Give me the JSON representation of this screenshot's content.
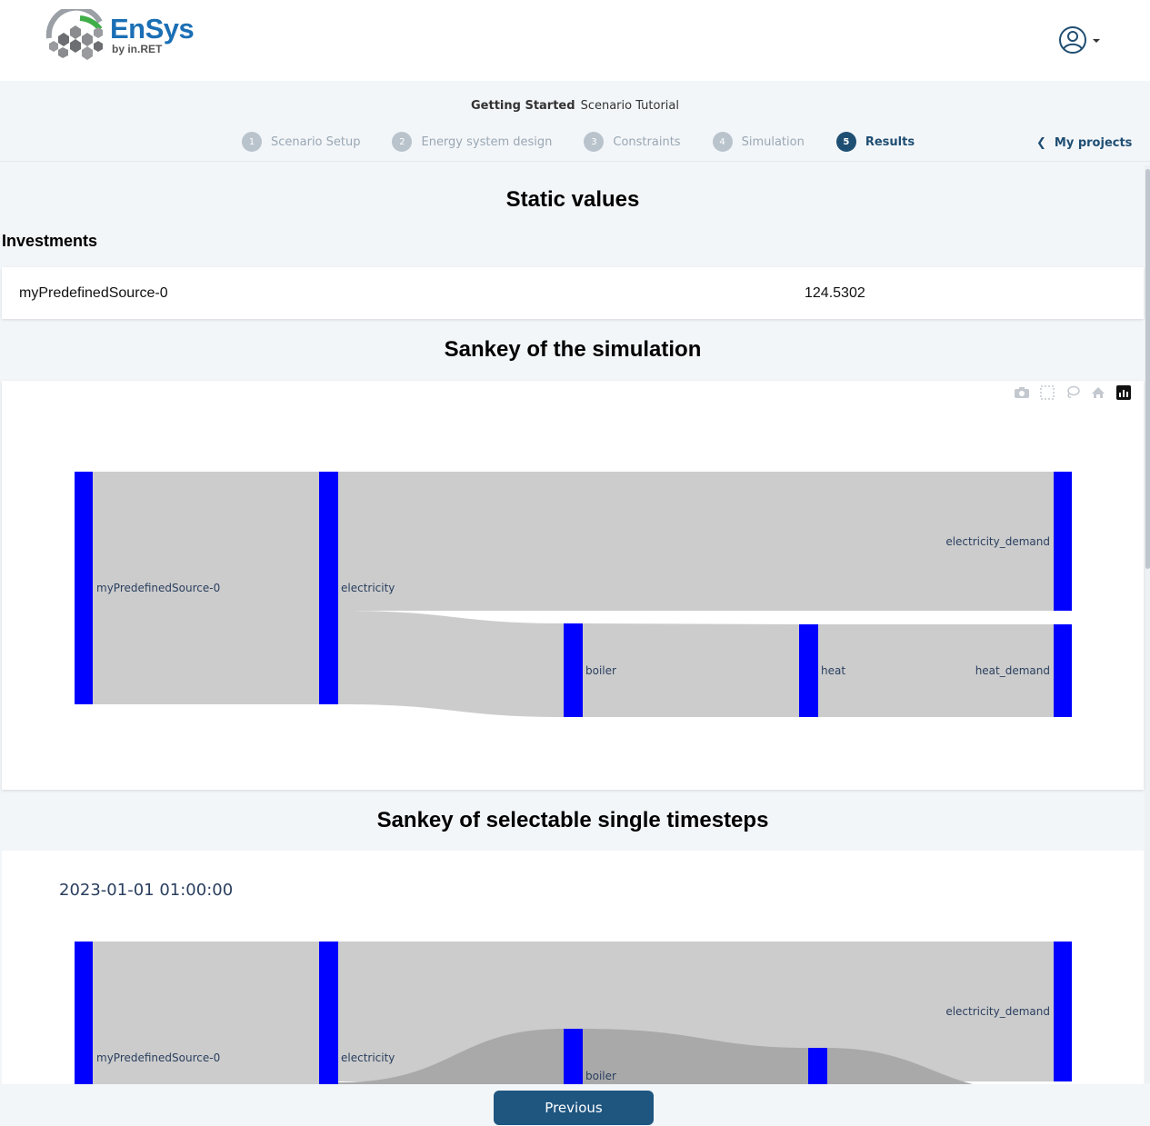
{
  "app": {
    "logo_text": "EnSys",
    "logo_sub": "by in.RET"
  },
  "header": {
    "crumb_section": "Getting Started",
    "crumb_project": "Scenario Tutorial",
    "steps": [
      {
        "num": "1",
        "label": "Scenario Setup"
      },
      {
        "num": "2",
        "label": "Energy system design"
      },
      {
        "num": "3",
        "label": "Constraints"
      },
      {
        "num": "4",
        "label": "Simulation"
      },
      {
        "num": "5",
        "label": "Results"
      }
    ],
    "my_projects": "My projects"
  },
  "results": {
    "static_title": "Static values",
    "investments_title": "Investments",
    "investments": [
      {
        "name": "myPredefinedSource-0",
        "value": "124.5302"
      }
    ],
    "sankey_title": "Sankey of the simulation",
    "sankey_timestep_title": "Sankey of selectable single timesteps",
    "timestep": "2023-01-01 01:00:00"
  },
  "chart_data": [
    {
      "type": "sankey",
      "nodes": [
        "myPredefinedSource-0",
        "electricity",
        "boiler",
        "heat",
        "electricity_demand",
        "heat_demand"
      ],
      "links": [
        {
          "source": "myPredefinedSource-0",
          "target": "electricity",
          "value": 1.0
        },
        {
          "source": "electricity",
          "target": "electricity_demand",
          "value": 0.6
        },
        {
          "source": "electricity",
          "target": "boiler",
          "value": 0.4
        },
        {
          "source": "boiler",
          "target": "heat",
          "value": 0.4
        },
        {
          "source": "heat",
          "target": "heat_demand",
          "value": 0.4
        }
      ],
      "node_color": "#0000ff",
      "link_color": "#cccccc"
    },
    {
      "type": "sankey",
      "nodes": [
        "myPredefinedSource-0",
        "electricity",
        "boiler",
        "electricity_demand"
      ],
      "node_color": "#0000ff",
      "link_color": "#cccccc"
    }
  ],
  "modebar": [
    "camera-icon",
    "box-select-icon",
    "lasso-icon",
    "home-icon",
    "plotly-logo-icon"
  ],
  "footer": {
    "previous": "Previous"
  }
}
